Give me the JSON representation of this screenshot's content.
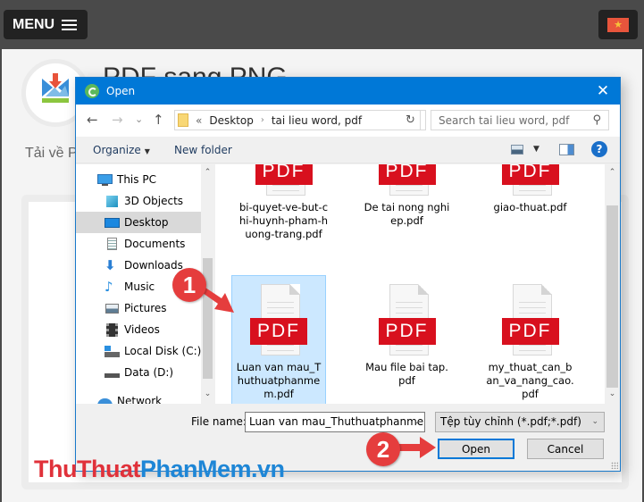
{
  "site": {
    "menu_label": "MENU",
    "lang_flag": "vietnam-flag",
    "title": "PDF sang PNG",
    "subtitle": "Tải về P",
    "watermark_red": "ThuThuat",
    "watermark_blue": "PhanMem.vn"
  },
  "dialog": {
    "title": "Open",
    "nav": {
      "back": "←",
      "forward": "→",
      "recent": "⌄",
      "up": "↑"
    },
    "address": {
      "overflow": "«",
      "crumbs": [
        "Desktop",
        "tai lieu word, pdf"
      ]
    },
    "search_placeholder": "Search tai lieu word, pdf",
    "toolbar": {
      "organize": "Organize",
      "new_folder": "New folder"
    },
    "sidebar": [
      {
        "label": "This PC",
        "icon": "computer-icon"
      },
      {
        "label": "3D Objects",
        "icon": "cube-icon"
      },
      {
        "label": "Desktop",
        "icon": "desktop-icon",
        "selected": true
      },
      {
        "label": "Documents",
        "icon": "document-icon"
      },
      {
        "label": "Downloads",
        "icon": "download-icon"
      },
      {
        "label": "Music",
        "icon": "music-icon"
      },
      {
        "label": "Pictures",
        "icon": "picture-icon"
      },
      {
        "label": "Videos",
        "icon": "video-icon"
      },
      {
        "label": "Local Disk (C:)",
        "icon": "drive-icon"
      },
      {
        "label": "Data (D:)",
        "icon": "drive-icon"
      },
      {
        "label": "Network",
        "icon": "network-icon"
      }
    ],
    "files": [
      {
        "name": "bi-quyet-ve-but-chi-huynh-pham-huong-trang.pdf",
        "badge": "PDF"
      },
      {
        "name": "De tai nong nghiep.pdf",
        "badge": "PDF"
      },
      {
        "name": "giao-thuat.pdf",
        "badge": "PDF"
      },
      {
        "name": "Luan van mau_Thuthuatphanmem.pdf",
        "badge": "PDF",
        "selected": true
      },
      {
        "name": "Mau file bai tap.pdf",
        "badge": "PDF"
      },
      {
        "name": "my_thuat_can_ban_va_nang_cao.pdf",
        "badge": "PDF"
      }
    ],
    "file_name_label": "File name:",
    "file_name_value": "Luan van mau_Thuthuatphanmem",
    "file_type": "Tệp tùy chỉnh (*.pdf;*.pdf)",
    "open_button": "Open",
    "cancel_button": "Cancel"
  },
  "annotations": {
    "step1": "1",
    "step2": "2",
    "accent": "#e53d3d"
  }
}
